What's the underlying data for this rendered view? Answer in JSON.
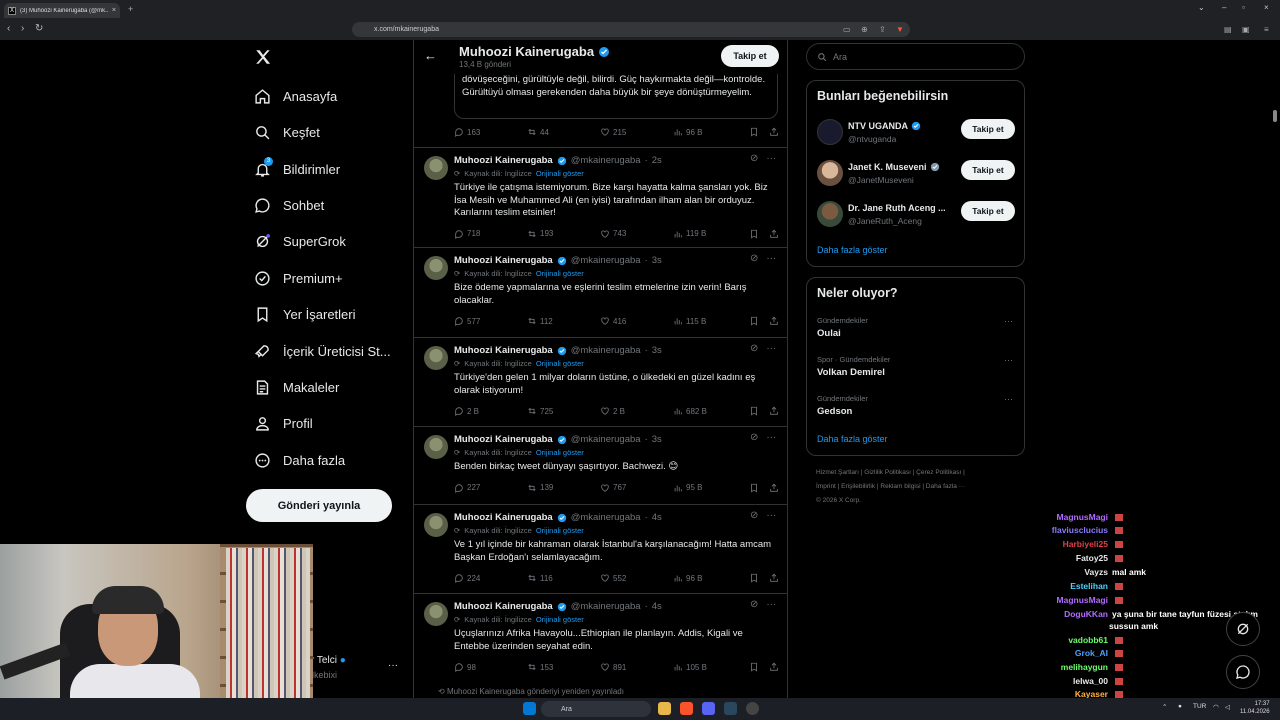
{
  "browser": {
    "tab_title": "(3) Muhoozi Kainerugaba (@mk...",
    "tab_favicon": "X",
    "url": "x.com/mkainerugaba"
  },
  "nav": {
    "items": [
      {
        "label": "Anasayfa",
        "icon": "home-icon"
      },
      {
        "label": "Keşfet",
        "icon": "search-icon"
      },
      {
        "label": "Bildirimler",
        "icon": "bell-icon",
        "badge": "3"
      },
      {
        "label": "Sohbet",
        "icon": "chat-icon"
      },
      {
        "label": "SuperGrok",
        "icon": "grok-icon"
      },
      {
        "label": "Premium+",
        "icon": "premium-icon"
      },
      {
        "label": "Yer İşaretleri",
        "icon": "bookmark-icon"
      },
      {
        "label": "İçerik Üreticisi St...",
        "icon": "rocket-icon"
      },
      {
        "label": "Makaleler",
        "icon": "article-icon"
      },
      {
        "label": "Profil",
        "icon": "person-icon"
      },
      {
        "label": "Daha fazla",
        "icon": "more-circle-icon"
      }
    ],
    "post_button": "Gönderi yayınla",
    "account_name": "lır Telci",
    "account_handle": "lkebixi"
  },
  "profile_header": {
    "name": "Muhoozi Kainerugaba",
    "post_count": "13,4 B gönderi",
    "follow_label": "Takip et"
  },
  "quoted_tweet": {
    "text": "dövüşeceğini, gürültüyle değil, bilirdi. Güç haykırmakta değil—kontrolde. Gürültüyü olması gerekenden daha büyük bir şeye dönüştürmeyelim.",
    "stats": {
      "replies": "163",
      "reposts": "44",
      "likes": "215",
      "views": "96 B"
    }
  },
  "tweets": [
    {
      "name": "Muhoozi Kainerugaba",
      "handle": "@mkainerugaba",
      "time": "2s",
      "source_lang": "Kaynak dili: İngilizce",
      "show_original": "Orijinali göster",
      "text": "Türkiye ile çatışma istemiyorum. Bize karşı hayatta kalma şansları yok. Biz İsa Mesih ve Muhammed Ali (en iyisi) tarafından ilham alan bir orduyuz. Karılarını teslim etsinler!",
      "replies": "718",
      "reposts": "193",
      "likes": "743",
      "views": "119 B"
    },
    {
      "name": "Muhoozi Kainerugaba",
      "handle": "@mkainerugaba",
      "time": "3s",
      "source_lang": "Kaynak dili: İngilizce",
      "show_original": "Orijinali göster",
      "text": "Bize ödeme yapmalarına ve eşlerini teslim etmelerine izin verin! Barış olacaklar.",
      "replies": "577",
      "reposts": "112",
      "likes": "416",
      "views": "115 B"
    },
    {
      "name": "Muhoozi Kainerugaba",
      "handle": "@mkainerugaba",
      "time": "3s",
      "source_lang": "Kaynak dili: İngilizce",
      "show_original": "Orijinali göster",
      "text": "Türkiye'den gelen 1 milyar doların üstüne, o ülkedeki en güzel kadını eş olarak istiyorum!",
      "replies": "2 B",
      "reposts": "725",
      "likes": "2 B",
      "views": "682 B"
    },
    {
      "name": "Muhoozi Kainerugaba",
      "handle": "@mkainerugaba",
      "time": "3s",
      "source_lang": "Kaynak dili: İngilizce",
      "show_original": "Orijinali göster",
      "text": "Benden birkaç tweet dünyayı şaşırtıyor. Bachwezi. 😊",
      "replies": "227",
      "reposts": "139",
      "likes": "767",
      "views": "95 B"
    },
    {
      "name": "Muhoozi Kainerugaba",
      "handle": "@mkainerugaba",
      "time": "4s",
      "source_lang": "Kaynak dili: İngilizce",
      "show_original": "Orijinali göster",
      "text": "Ve 1 yıl içinde bir kahraman olarak İstanbul'a karşılanacağım! Hatta amcam Başkan Erdoğan'ı selamlayacağım.",
      "replies": "224",
      "reposts": "116",
      "likes": "552",
      "views": "96 B"
    },
    {
      "name": "Muhoozi Kainerugaba",
      "handle": "@mkainerugaba",
      "time": "4s",
      "source_lang": "Kaynak dili: İngilizce",
      "show_original": "Orijinali göster",
      "text": "Uçuşlarınızı Afrika Havayolu...Ethiopian ile planlayın. Addis, Kigali ve Entebbe üzerinden seyahat edin.",
      "replies": "98",
      "reposts": "153",
      "likes": "891",
      "views": "105 B"
    }
  ],
  "repost_note": "Muhoozi Kainerugaba gönderiyi yeniden yayınladı",
  "right": {
    "search_placeholder": "Ara",
    "suggest_title": "Bunları beğenebilirsin",
    "suggestions": [
      {
        "name": "NTV UGANDA",
        "handle": "@ntvuganda",
        "button": "Takip et"
      },
      {
        "name": "Janet K. Museveni",
        "handle": "@JanetMuseveni",
        "button": "Takip et"
      },
      {
        "name": "Dr. Jane Ruth Aceng ...",
        "handle": "@JaneRuth_Aceng",
        "button": "Takip et"
      }
    ],
    "show_more": "Daha fazla göster",
    "trends_title": "Neler oluyor?",
    "trends": [
      {
        "category": "Gündemdekiler",
        "title": "Oulai"
      },
      {
        "category": "Spor · Gündemdekiler",
        "title": "Volkan Demirel"
      },
      {
        "category": "Gündemdekiler",
        "title": "Gedson"
      }
    ],
    "footer_line1": "Hizmet Şartları  |  Gizlilik Politikası  |  Çerez Politikası  |",
    "footer_line2": "İmprint  |  Erişilebilirlik  |  Reklam bilgisi  |  Daha fazla ···",
    "footer_line3": "© 2026 X Corp."
  },
  "chat": [
    {
      "user": "MagnusMagi",
      "msg": "",
      "color": "#b36bff"
    },
    {
      "user": "flaviusclucius",
      "msg": "",
      "color": "#8a7bff"
    },
    {
      "user": "Harbiyeli25",
      "msg": "",
      "color": "#e0404a"
    },
    {
      "user": "Fatoy25",
      "msg": "",
      "color": "#e7e9ea"
    },
    {
      "user": "Vayzs",
      "msg": "mal amk",
      "color": "#e7e9ea"
    },
    {
      "user": "Estelihan",
      "msg": "",
      "color": "#4fd1ff"
    },
    {
      "user": "MagnusMagi",
      "msg": "",
      "color": "#b36bff"
    },
    {
      "user": "DoguKKan",
      "msg": "ya şuna bir tane tayfun füzesi atalım",
      "color": "#b36bff"
    },
    {
      "user": "",
      "msg": "sussun amk",
      "color": "#e7e9ea"
    },
    {
      "user": "vadobb61",
      "msg": "",
      "color": "#6bff6b"
    },
    {
      "user": "Grok_AI",
      "msg": "",
      "color": "#4fa0ff"
    },
    {
      "user": "melihaygun",
      "msg": "",
      "color": "#6bff6b"
    },
    {
      "user": "lelwa_00",
      "msg": "",
      "color": "#e7e9ea"
    },
    {
      "user": "Kayaser",
      "msg": "",
      "color": "#ffb347"
    },
    {
      "user": "omur0000",
      "msg": "",
      "color": "#e7e9ea"
    }
  ],
  "taskbar": {
    "search_placeholder": "Ara",
    "lang": "TUR",
    "time": "17:37",
    "date": "11.04.2026"
  },
  "colors": {
    "accent": "#1d9bf0",
    "background": "#000000",
    "muted": "#71767b"
  }
}
